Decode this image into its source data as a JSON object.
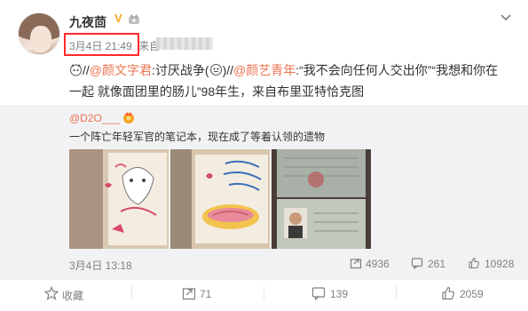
{
  "post": {
    "username": "九夜茴",
    "vip_badge": "V",
    "time": "3月4日 21:49",
    "source_prefix": "来自",
    "line1": {
      "mention1": "@颜文字君",
      "text1": ":讨厌战争(",
      "mention_sep": ")//",
      "mention2": "@颜艺青年",
      "text2": ":“我不会向任何人交出你”“我想和你在"
    },
    "line2": "一起 就像面团里的肠儿”98年生，来自布里亚特恰克图"
  },
  "repost": {
    "user": "@D2O___",
    "text": "一个阵亡年轻军官的笔记本，现在成了等着认领的遗物",
    "time": "3月4日 13:18",
    "shares": "4936",
    "comments": "261",
    "likes": "10928",
    "photos": [
      {
        "icon": "notebook-photo"
      },
      {
        "icon": "notebook-photo"
      },
      {
        "icon": "passport-photo"
      }
    ]
  },
  "actions": {
    "favorite": "收藏",
    "repost": "71",
    "comment": "139",
    "like": "2059"
  },
  "colors": {
    "link": "#eb7350",
    "highlight": "#ff2a2a",
    "muted": "#808080",
    "repost_bg": "#f2f2f5"
  }
}
